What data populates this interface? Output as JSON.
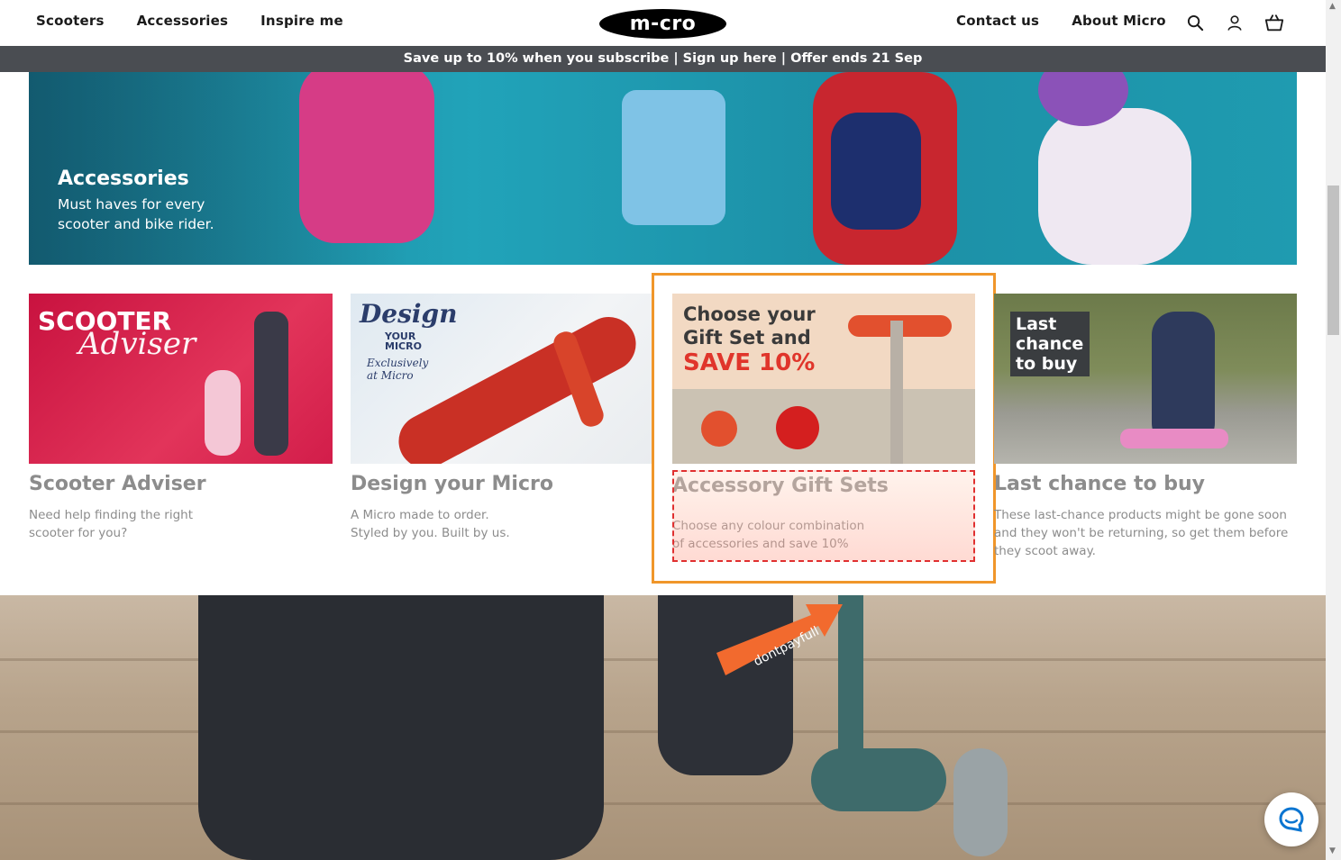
{
  "header": {
    "nav_left": [
      "Scooters",
      "Accessories",
      "Inspire me"
    ],
    "logo": "m-cro",
    "nav_right": [
      "Contact us",
      "About Micro"
    ],
    "icons": [
      "search-icon",
      "account-icon",
      "basket-icon"
    ]
  },
  "promo": {
    "text": "Save up to 10% when you subscribe | Sign up here | Offer ends 21 Sep"
  },
  "hero": {
    "title": "Accessories",
    "subtitle": "Must haves for every scooter and bike rider."
  },
  "cards": [
    {
      "image_text_1": "SCOOTER",
      "image_text_2": "Adviser",
      "title": "Scooter Adviser",
      "desc": "Need help finding the right scooter for you?"
    },
    {
      "image_text_1": "Design",
      "image_text_2": "YOUR MICRO",
      "image_text_3": "Exclusively at Micro",
      "title": "Design your Micro",
      "desc": "A Micro made to order. Styled by you. Built by us."
    },
    {
      "image_text_1": "Choose your Gift Set and",
      "image_text_2": "SAVE 10%",
      "title": "Accessory Gift Sets",
      "desc": "Choose any colour combination of accessories and save 10%"
    },
    {
      "image_text_1": "Last chance to buy",
      "title": "Last chance to buy",
      "desc": "These last-chance products might be gone soon and they won't be returning, so get them before they scoot away."
    }
  ],
  "overlay": {
    "badge": "dontpayfull"
  },
  "colors": {
    "promo_bg": "#4a4d52",
    "hero_bg": "#1f9bb0",
    "highlight": "#f0962a",
    "save_red": "#e0352b"
  }
}
